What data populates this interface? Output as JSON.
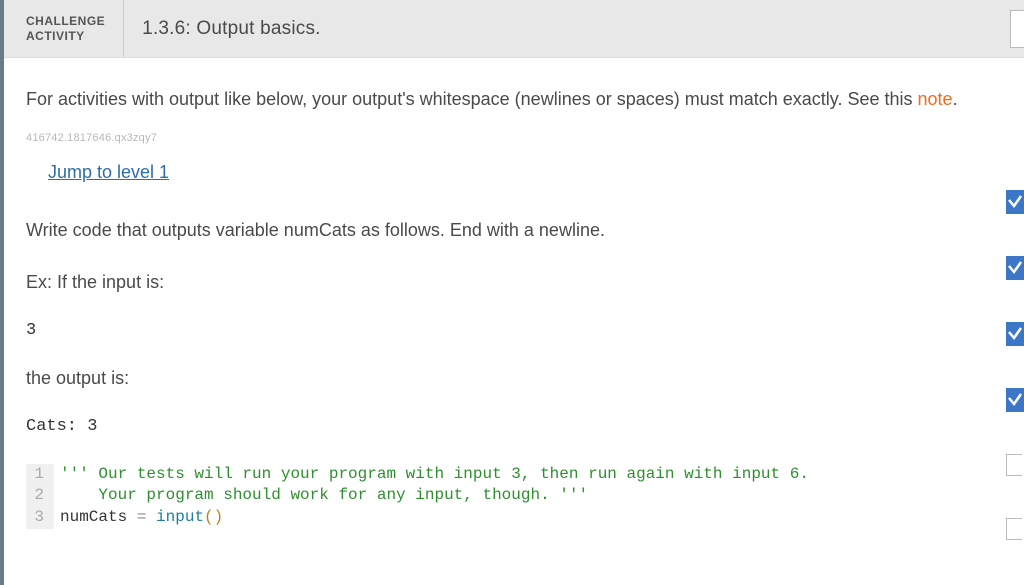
{
  "header": {
    "badge_line1": "CHALLENGE",
    "badge_line2": "ACTIVITY",
    "title": "1.3.6: Output basics."
  },
  "intro": {
    "text_before": "For activities with output like below, your output's whitespace (newlines or spaces) must match exactly. See this ",
    "note_link": "note",
    "text_after": "."
  },
  "trace_id": "416742.1817646.qx3zqy7",
  "jump_label": "Jump to level 1",
  "prompt": "Write code that outputs variable numCats as follows. End with a newline.",
  "example": {
    "label": "Ex: If the input is:",
    "input_value": "3",
    "output_label": "the output is:",
    "output_value": "Cats: 3"
  },
  "code": {
    "lines": [
      {
        "num": "1",
        "tokens": [
          {
            "cls": "tok-str",
            "t": "''' Our tests will run your program with input 3, then run again with input 6."
          }
        ]
      },
      {
        "num": "2",
        "tokens": [
          {
            "cls": "tok-str",
            "t": "    Your program should work for any input, though. '''"
          }
        ]
      },
      {
        "num": "3",
        "tokens": [
          {
            "cls": "tok-id",
            "t": "numCats "
          },
          {
            "cls": "tok-op",
            "t": "="
          },
          {
            "cls": "tok-id",
            "t": " "
          },
          {
            "cls": "tok-fn",
            "t": "input"
          },
          {
            "cls": "tok-par",
            "t": "()"
          }
        ]
      }
    ]
  }
}
